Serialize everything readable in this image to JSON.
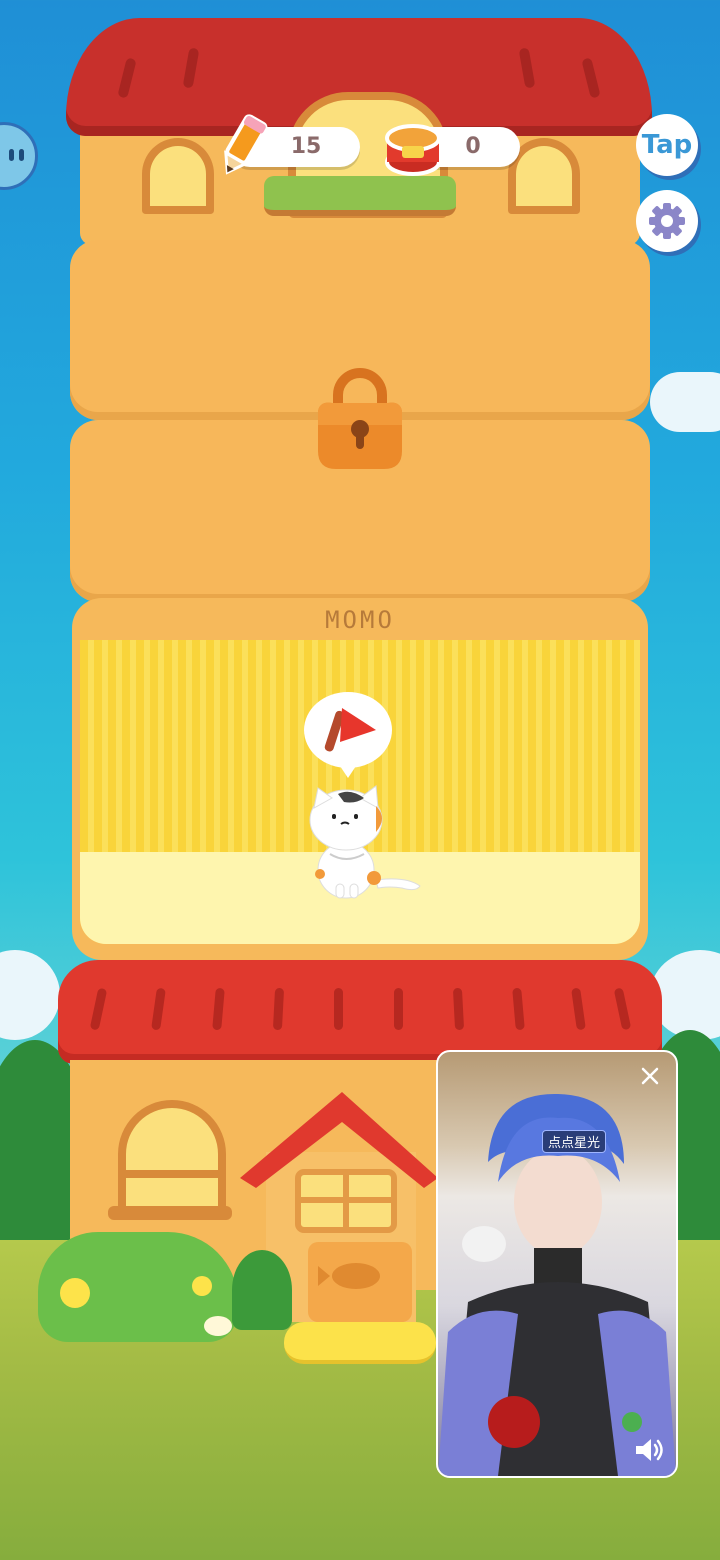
{
  "hud": {
    "pencil_count": "15",
    "can_count": "0",
    "tap_label": "Tap"
  },
  "floor": {
    "sign_text": "MOMO"
  },
  "video_ad": {
    "badge_text": "点点星光"
  },
  "colors": {
    "roof_red": "#c8302c",
    "wall_orange": "#f6b95b",
    "room_yellow": "#f9d43a",
    "lock_orange": "#ec8a2a",
    "accent_blue": "#3a98d6"
  }
}
